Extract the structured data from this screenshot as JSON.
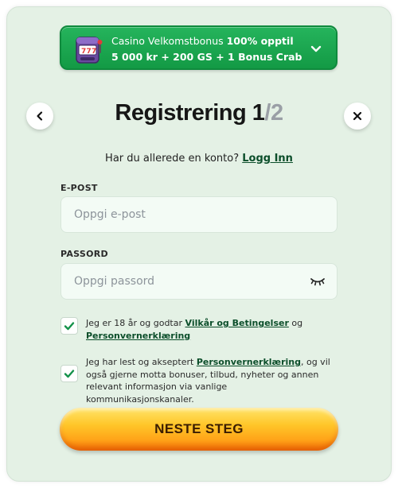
{
  "bonus": {
    "text_prefix": "Casino Velkomstbonus ",
    "text_highlight": "100% opptil",
    "offer": "5 000 kr + 200 GS + 1 Bonus Crab",
    "icon": "slot-machine-icon",
    "expand_icon": "chevron-down-icon"
  },
  "header": {
    "title": "Registrering ",
    "step_current": "1",
    "step_total": "/2",
    "back_icon": "chevron-left-icon",
    "close_icon": "close-icon"
  },
  "login": {
    "prompt": "Har du allerede en konto? ",
    "link": "Logg Inn"
  },
  "form": {
    "email_label": "E-POST",
    "email_placeholder": "Oppgi e-post",
    "email_value": "",
    "password_label": "PASSORD",
    "password_placeholder": "Oppgi passord",
    "password_value": "",
    "password_toggle_icon": "eye-closed-icon"
  },
  "consents": [
    {
      "checked": true,
      "text_1": "Jeg er 18 år og godtar ",
      "link_1": "Vilkår og Betingelser",
      "text_2": " og ",
      "link_2": "Personvernerklæring"
    },
    {
      "checked": true,
      "text_1": "Jeg har lest og akseptert ",
      "link_1": "Personvernerklæring",
      "text_2": ", og vil også gjerne motta bonuser, tilbud, nyheter og annen relevant informasjon via vanlige kommunikasjonskanaler."
    }
  ],
  "cta": {
    "label": "NESTE STEG"
  },
  "colors": {
    "background": "#e4f1e5",
    "bonus_green": "#1aa84f",
    "link_green": "#0b4e2a",
    "cta_yellow": "#ffc629",
    "cta_orange": "#f06b06",
    "check_green": "#14924a"
  }
}
